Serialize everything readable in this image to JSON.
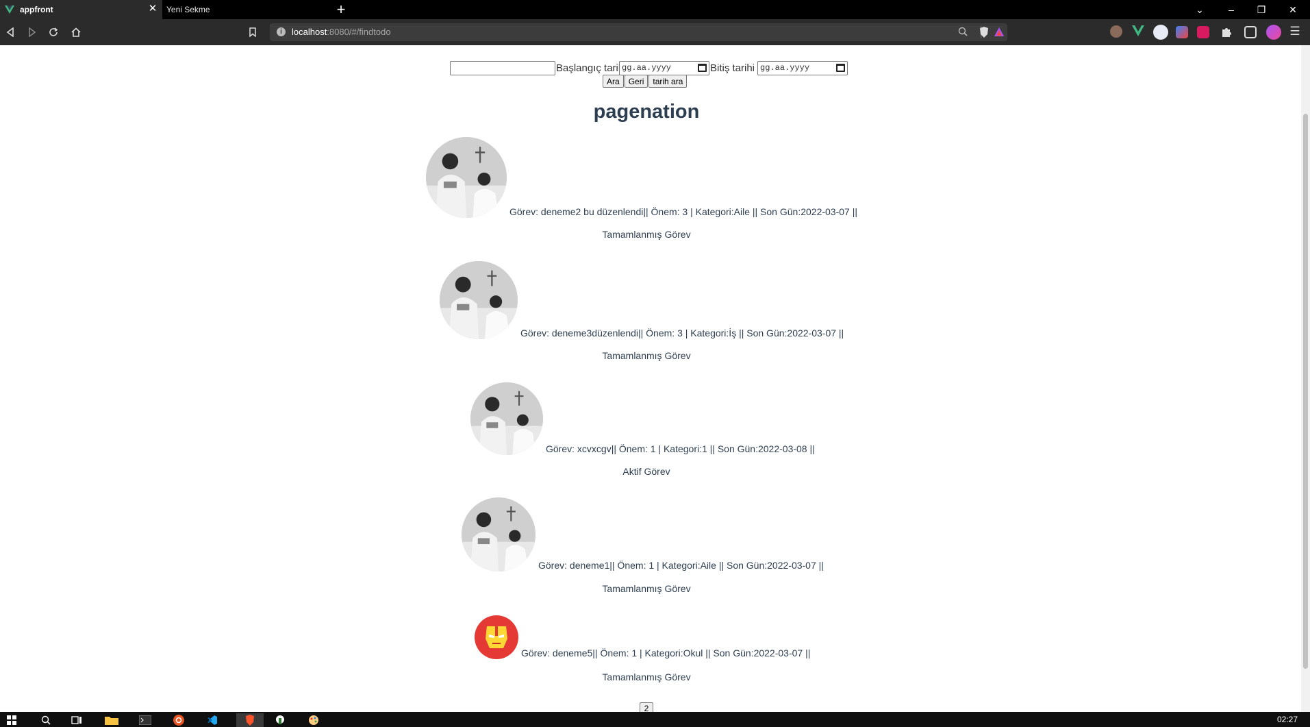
{
  "browser": {
    "tabs": [
      {
        "title": "appfront",
        "active": true
      },
      {
        "title": "Yeni Sekme",
        "active": false
      }
    ],
    "url": {
      "host": "localhost",
      "rest": ":8080/#/findtodo"
    }
  },
  "search": {
    "start_label": "Başlangıç tarihi",
    "end_label": "Bitiş tarihi",
    "date_placeholder": "gg.aa.yyyy",
    "buttons": {
      "search": "Ara",
      "back": "Geri",
      "date_search": "tarih ara"
    }
  },
  "title": "pagenation",
  "todos": [
    {
      "text": "Görev: deneme2 bu düzenlendi|| Önem: 3 | Kategori:Aile || Son Gün:2022-03-07 ||",
      "status": "Tamamlanmış Görev",
      "avatar": "photo"
    },
    {
      "text": "Görev: deneme3düzenlendi|| Önem: 3 | Kategori:İş || Son Gün:2022-03-07 ||",
      "status": "Tamamlanmış Görev",
      "avatar": "photo"
    },
    {
      "text": "Görev: xcvxcgv|| Önem: 1 | Kategori:1 || Son Gün:2022-03-08 ||",
      "status": "Aktif Görev",
      "avatar": "photo"
    },
    {
      "text": "Görev: deneme1|| Önem: 1 | Kategori:Aile || Son Gün:2022-03-07 ||",
      "status": "Tamamlanmış Görev",
      "avatar": "photo"
    },
    {
      "text": "Görev: deneme5|| Önem: 1 | Kategori:Okul || Son Gün:2022-03-07 ||",
      "status": "Tamamlanmış Görev",
      "avatar": "ironman"
    }
  ],
  "pagination": {
    "page": "2"
  },
  "taskbar": {
    "clock": "02:27"
  },
  "colors": {
    "text": "#2c3e50",
    "chrome": "#2b2b2b",
    "avatar_ironman_bg": "#e53935"
  }
}
